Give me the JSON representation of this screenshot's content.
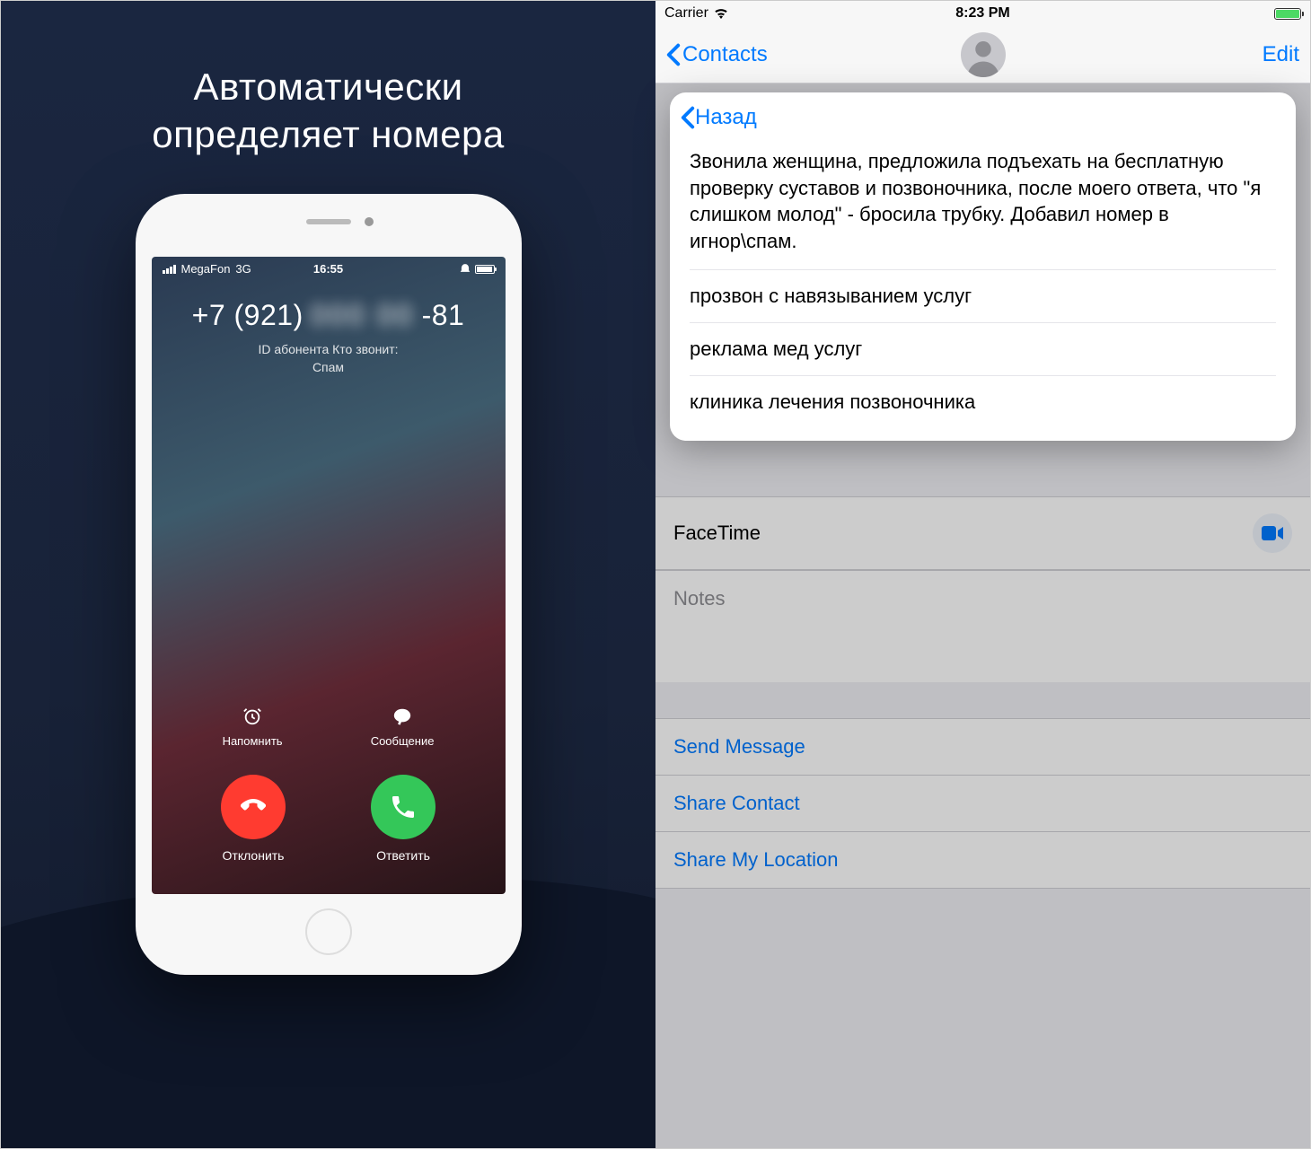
{
  "left": {
    "promo_line1": "Автоматически",
    "promo_line2": "определяет номера",
    "phone_status": {
      "carrier": "MegaFon",
      "network": "3G",
      "time": "16:55"
    },
    "call": {
      "number_prefix": "+7 (921)",
      "number_suffix": "-81",
      "caller_id_label": "ID абонента Кто звонит:",
      "caller_id_value": "Спам"
    },
    "actions": {
      "remind": "Напомнить",
      "message": "Сообщение",
      "decline": "Отклонить",
      "answer": "Ответить"
    }
  },
  "right": {
    "status": {
      "carrier": "Carrier",
      "time": "8:23 PM"
    },
    "nav": {
      "back": "Contacts",
      "edit": "Edit"
    },
    "popup": {
      "back": "Назад",
      "main_comment": "Звонила женщина, предложила подъехать на бесплатную проверку суставов и позвоночника, после моего ответа, что \"я слишком молод\" - бросила трубку. Добавил номер в игнор\\спам.",
      "comments": [
        "прозвон с навязыванием услуг",
        "реклама мед услуг",
        "клиника лечения позвоночника"
      ]
    },
    "rows": {
      "facetime": "FaceTime",
      "notes": "Notes",
      "send_message": "Send Message",
      "share_contact": "Share Contact",
      "share_location": "Share My Location"
    }
  }
}
